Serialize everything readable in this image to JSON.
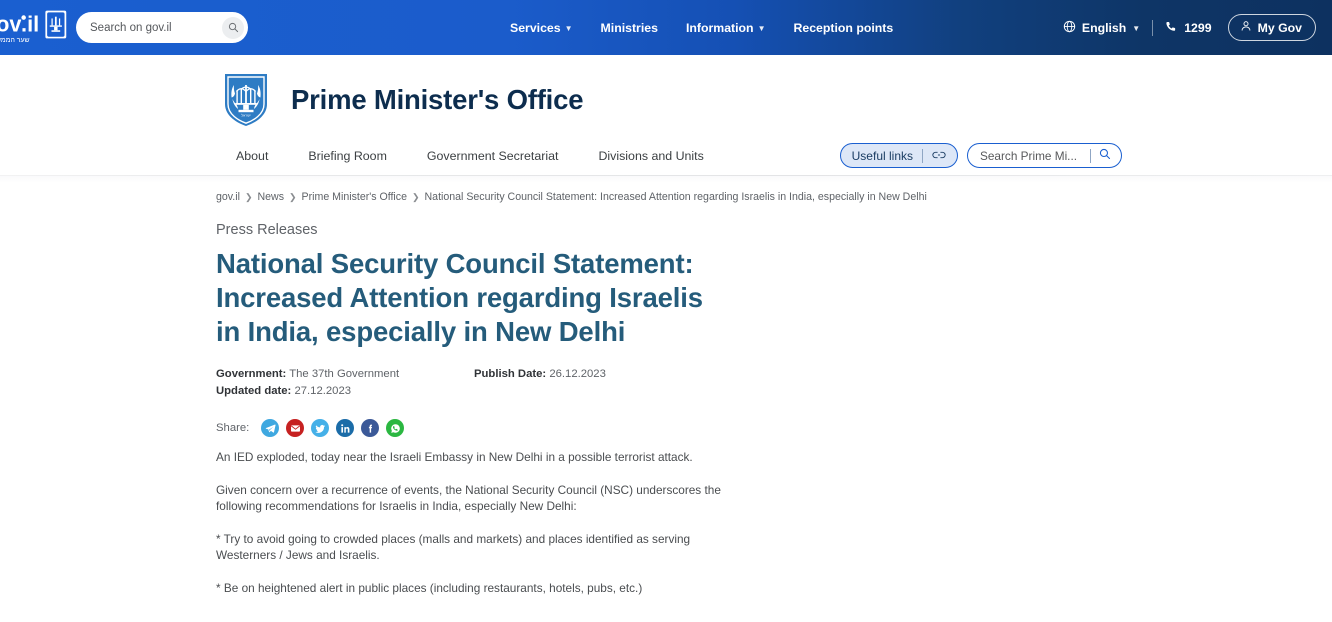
{
  "topbar": {
    "logo_alt": "gov.il",
    "logo_hebrew": "שער הממשלה",
    "search_placeholder": "Search on gov.il",
    "search_value": "",
    "nav": [
      {
        "label": "Services",
        "has_caret": true
      },
      {
        "label": "Ministries",
        "has_caret": false
      },
      {
        "label": "Information",
        "has_caret": true
      },
      {
        "label": "Reception points",
        "has_caret": false
      }
    ],
    "language": "English",
    "phone": "1299",
    "mygov": "My Gov"
  },
  "header": {
    "office_title": "Prime Minister's Office",
    "emblem_name": "israel-state-emblem",
    "subnav": [
      {
        "label": "About"
      },
      {
        "label": "Briefing Room"
      },
      {
        "label": "Government Secretariat"
      },
      {
        "label": "Divisions and Units"
      }
    ],
    "useful_links_label": "Useful links",
    "site_search_placeholder": "Search Prime Mi...",
    "site_search_value": ""
  },
  "breadcrumb": [
    "gov.il",
    "News",
    "Prime Minister's Office",
    "National Security Council Statement: Increased Attention regarding Israelis in India, especially in New Delhi"
  ],
  "article": {
    "kicker": "Press Releases",
    "title": "National Security Council Statement: Increased Attention regarding Israelis in India, especially in New Delhi",
    "meta": {
      "government_label": "Government:",
      "government_value": "The 37th Government",
      "updated_label": "Updated date:",
      "updated_value": "27.12.2023",
      "publish_label": "Publish Date:",
      "publish_value": "26.12.2023"
    },
    "share_label": "Share:",
    "share_icons": [
      {
        "name": "telegram-share-icon",
        "color": "#3fa8e0"
      },
      {
        "name": "email-share-icon",
        "color": "#c62121"
      },
      {
        "name": "twitter-share-icon",
        "color": "#45b0e8"
      },
      {
        "name": "linkedin-share-icon",
        "color": "#1b6ca8"
      },
      {
        "name": "facebook-share-icon",
        "color": "#3b5998"
      },
      {
        "name": "whatsapp-share-icon",
        "color": "#2bb741"
      }
    ],
    "paragraphs": [
      "An IED exploded, today near the Israeli Embassy in New Delhi in a possible terrorist attack.",
      "Given concern over a recurrence of events, the National Security Council (NSC) underscores the following recommendations for Israelis in India, especially New Delhi:",
      "* Try to avoid going to crowded places (malls and markets) and places identified as serving Westerners / Jews and Israelis.",
      "* Be on heightened alert in public places (including restaurants, hotels, pubs, etc.)"
    ]
  },
  "colors": {
    "gov_blue": "#1a5fd0",
    "gov_navy": "#0d3160",
    "title_teal": "#255c7b",
    "header_navy": "#0d2d4e"
  }
}
